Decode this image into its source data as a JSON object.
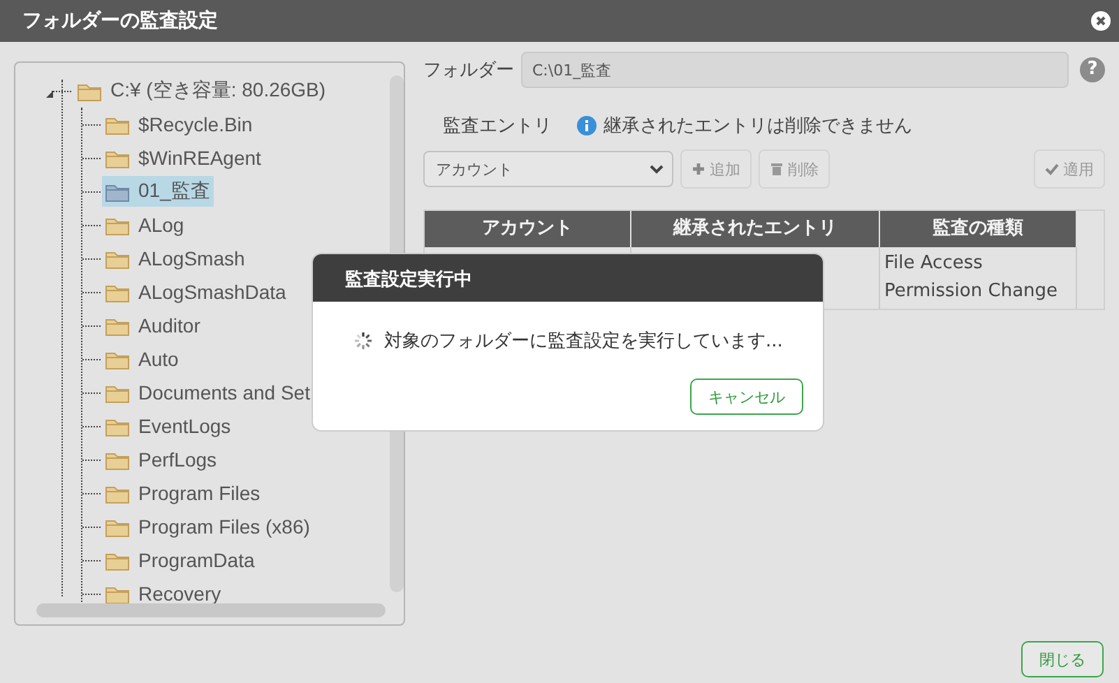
{
  "window": {
    "title": "フォルダーの監査設定"
  },
  "tree": {
    "label": "C:¥ (空き容量: 80.26GB)",
    "expanded": true,
    "selected": false,
    "children": [
      {
        "label": "$Recycle.Bin",
        "selected": false
      },
      {
        "label": "$WinREAgent",
        "selected": false
      },
      {
        "label": "01_監査",
        "selected": true
      },
      {
        "label": "ALog",
        "selected": false
      },
      {
        "label": "ALogSmash",
        "selected": false
      },
      {
        "label": "ALogSmashData",
        "selected": false
      },
      {
        "label": "Auditor",
        "selected": false
      },
      {
        "label": "Auto",
        "selected": false
      },
      {
        "label": "Documents and Set",
        "selected": false
      },
      {
        "label": "EventLogs",
        "selected": false
      },
      {
        "label": "PerfLogs",
        "selected": false
      },
      {
        "label": "Program Files",
        "selected": false
      },
      {
        "label": "Program Files (x86)",
        "selected": false
      },
      {
        "label": "ProgramData",
        "selected": false
      },
      {
        "label": "Recovery",
        "selected": false
      }
    ]
  },
  "folder": {
    "label": "フォルダー",
    "value": "C:\\01_監査",
    "help": "?"
  },
  "audit_entries": {
    "label": "監査エントリ",
    "info": "継承されたエントリは削除できません"
  },
  "toolbar": {
    "account_select": "アカウント",
    "buttons": [
      {
        "kind": "add",
        "label": "追加",
        "disabled": true
      },
      {
        "kind": "delete",
        "label": "削除",
        "disabled": true
      },
      {
        "kind": "apply",
        "label": "適用",
        "disabled": true
      }
    ]
  },
  "table": {
    "columns": [
      "アカウント",
      "継承されたエントリ",
      "監査の種類"
    ],
    "rows": [
      {
        "audit_types": [
          "File Access",
          "Permission Change"
        ]
      }
    ]
  },
  "dialog": {
    "title": "監査設定実行中",
    "message": "対象のフォルダーに監査設定を実行しています...",
    "buttons": [
      "キャンセル"
    ]
  },
  "buttons": [
    "閉じる"
  ]
}
